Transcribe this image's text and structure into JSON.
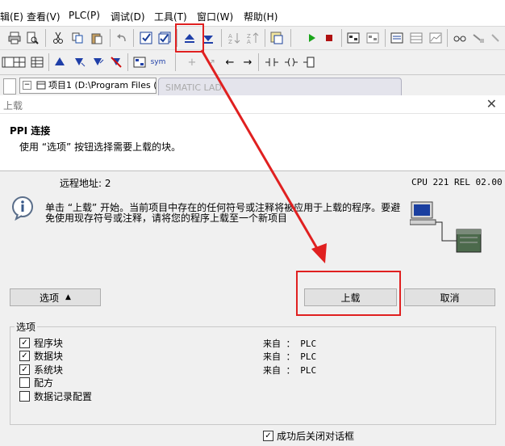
{
  "menu": {
    "items": [
      "辑(E)",
      "查看(V)",
      "PLC(P)",
      "调试(D)",
      "工具(T)",
      "窗口(W)",
      "帮助(H)"
    ]
  },
  "toolbar2": {
    "sym_label": "sym"
  },
  "tree": {
    "root_label": "项目1 (D:\\Program Files ("
  },
  "sim_tab": {
    "label": "SIMATIC LAD"
  },
  "dialog": {
    "title": "上载",
    "header": {
      "title": "PPI 连接",
      "subtitle": "使用 “选项” 按钮选择需要上载的块。"
    },
    "remote_address_label": "远程地址:  2",
    "cpu_info": "CPU 221  REL 02.00",
    "info_line1": "单击 “上载” 开始。当前项目中存在的任何符号或注释将被应用于上载的程序。要避",
    "info_line2": "免使用现存符号或注释，请将您的程序上载至一个新项目",
    "options_button": "选项",
    "options_arrow": "▲",
    "upload_button": "上载",
    "cancel_button": "取消",
    "options_group_label": "选项",
    "options": [
      {
        "label": "程序块",
        "checked": true,
        "source": "来自 ： PLC"
      },
      {
        "label": "数据块",
        "checked": true,
        "source": "来自 ： PLC"
      },
      {
        "label": "系统块",
        "checked": true,
        "source": "来自 ： PLC"
      },
      {
        "label": "配方",
        "checked": false,
        "source": ""
      },
      {
        "label": "数据记录配置",
        "checked": false,
        "source": ""
      }
    ],
    "close_on_success": {
      "label": "成功后关闭对话框",
      "checked": true
    }
  },
  "annotation": {
    "color": "#e02020"
  }
}
